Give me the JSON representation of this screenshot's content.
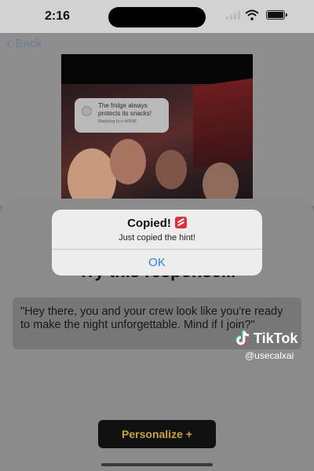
{
  "status_bar": {
    "time": "2:16"
  },
  "nav": {
    "back_label": "Back"
  },
  "photo": {
    "bubble_message": "The fridge always protects its snacks!",
    "bubble_reply": "Replying to n.h0596"
  },
  "sheet": {
    "title": "Try this response...",
    "response": "\"Hey there, you and your crew look like you're ready to make the night unforgettable. Mind if I join?\"",
    "personalize_label": "Personalize +"
  },
  "alert": {
    "title": "Copied!",
    "message": "Just copied the hint!",
    "ok_label": "OK"
  },
  "watermark": {
    "brand": "TikTok",
    "handle": "@usecalxai"
  },
  "colors": {
    "accent_gold": "#c9a33d",
    "link_blue": "#2f7de1"
  }
}
